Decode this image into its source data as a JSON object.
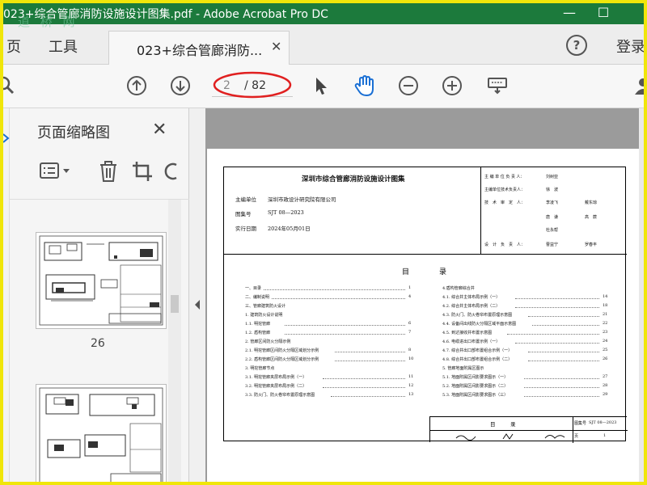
{
  "window": {
    "title": "023+综合管廊消防设施设计图集.pdf - Adobe Acrobat Pro DC",
    "minimize": "—",
    "maximize": "☐",
    "watermark": "道 桥 网"
  },
  "menubar": {
    "home_fragment": "页",
    "tools": "工具",
    "tab_label": "023+综合管廊消防...",
    "tab_close": "✕",
    "help": "?",
    "login": "登录"
  },
  "toolbar": {
    "current_page": "2",
    "total_pages": "/ 82",
    "icons": [
      "search-icon",
      "page-up-icon",
      "page-down-icon",
      "select-arrow-icon",
      "hand-tool-icon",
      "zoom-out-icon",
      "zoom-in-icon",
      "keyboard-tool-icon",
      "user-icon"
    ]
  },
  "thumbnails": {
    "title": "页面缩略图",
    "close": "✕",
    "page_label": "26",
    "tools": [
      "options-list-icon",
      "delete-icon",
      "crop-icon",
      "rotate-icon"
    ]
  },
  "document": {
    "sheet_title": "深圳市综合管廊消防设施设计图集",
    "editor_unit_label": "主编单位",
    "editor_unit": "深圳市政设计研究院有限公司",
    "set_no_label": "图集号",
    "set_no": "SJT 08—2023",
    "date_label": "实行日期",
    "date": "2024年05月01日",
    "right": {
      "r1_label": "主 编 单 位 负 责 人：",
      "r1_name": "刘树亚",
      "r2_label": "主编单位技术负责人：",
      "r2_name": "徐　波",
      "r3_label": "技　术　审　定　人：",
      "r3_names_a": "李凌飞",
      "r3_names_b": "戴东琼",
      "r3_names_c": "唐　谦",
      "r3_names_d": "高　蕨",
      "r3_names_e": "杜永帮",
      "r4_label": "设　计　负　责　人：",
      "r4_name_a": "曹益宁",
      "r4_name_b": "罗春丰"
    },
    "toc_title": "目　录",
    "toc_left": [
      {
        "label": "一、目录",
        "page": "1"
      },
      {
        "label": "二、编制说明",
        "page": "4"
      },
      {
        "label": "三、管廊建筑防火设计",
        "page": ""
      },
      {
        "label": "1. 建筑防火设计说明",
        "page": ""
      },
      {
        "label": "1.1. 明挖管廊",
        "page": "6"
      },
      {
        "label": "1.2. 盾构管廊",
        "page": "7"
      },
      {
        "label": "2. 管廊区间防火分隔示例",
        "page": ""
      },
      {
        "label": "2.1. 明挖管廊区间防火分隔区域划分示例",
        "page": "8"
      },
      {
        "label": "2.2. 盾构管廊区间防火分隔区域划分示例",
        "page": "10"
      },
      {
        "label": "3. 明挖管廊节点",
        "page": ""
      },
      {
        "label": "3.1. 明挖管廊夹层布局示例（一）",
        "page": "11"
      },
      {
        "label": "3.2. 明挖管廊夹层布局示例（二）",
        "page": "12"
      },
      {
        "label": "3.3. 防火门、防火卷帘布置原理示意图",
        "page": "13"
      }
    ],
    "toc_right": [
      {
        "label": "4.盾构管廊综合井",
        "page": ""
      },
      {
        "label": "4.1. 综合井主体布局示例（一）",
        "page": "14"
      },
      {
        "label": "4.2. 综合井主体布局示例（二）",
        "page": "18"
      },
      {
        "label": "4.3. 防火门、防火卷帘布置原理示意图",
        "page": "21"
      },
      {
        "label": "4.4. 设备间出线防火分隔区域平面示意图",
        "page": "22"
      },
      {
        "label": "4.5. 到达接收井布置示意图",
        "page": "23"
      },
      {
        "label": "4.6. 电缆进出口布置示例（一）",
        "page": "24"
      },
      {
        "label": "4.7. 综合井出口部布置组合示例（一）",
        "page": "25"
      },
      {
        "label": "4.8. 综合井出口部布置组合示例（二）",
        "page": "26"
      },
      {
        "label": "5. 管廊地面附属区图示",
        "page": ""
      },
      {
        "label": "5.1. 地面附属区间影要求图示（一）",
        "page": "27"
      },
      {
        "label": "5.2. 地面附属区间影要求图示（二）",
        "page": "28"
      },
      {
        "label": "5.3. 地面附属区间影要求图示（三）",
        "page": "29"
      }
    ],
    "stamp_title": "目　录",
    "stamp_set_label": "图集号",
    "stamp_set_no": "SJT 08—2023",
    "stamp_page_label": "页",
    "stamp_page": "1"
  }
}
